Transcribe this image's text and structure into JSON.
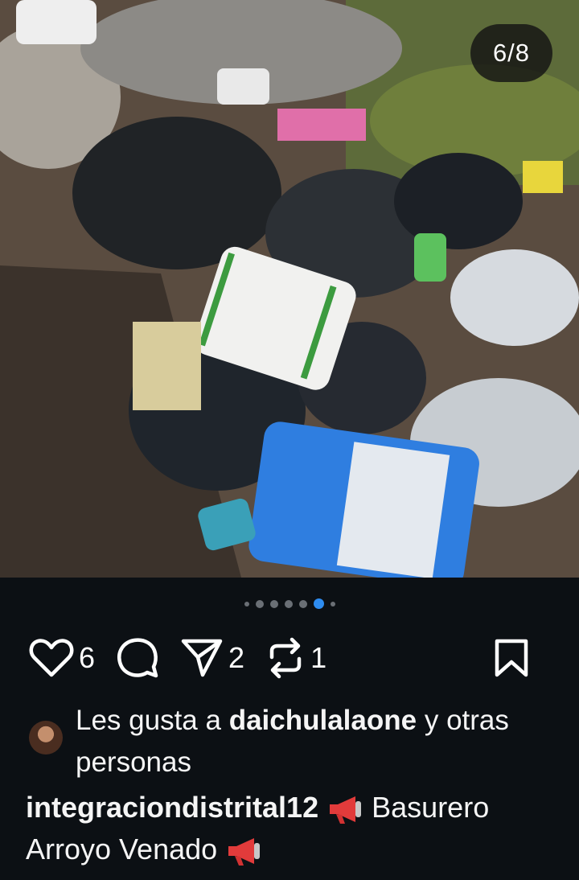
{
  "post": {
    "image_counter": "6/8",
    "carousel": {
      "total_dots": 7,
      "active_index": 5
    }
  },
  "actions": {
    "likes_count": "6",
    "shares_count": "2",
    "reposts_count": "1"
  },
  "likes": {
    "prefix": "Les gusta a",
    "user": "daichulalaone",
    "suffix": "y otras personas"
  },
  "caption": {
    "username": "integraciondistrital12",
    "text_part1": "Basurero Arroyo Venado",
    "emoji": "megaphone-icon"
  },
  "colors": {
    "background": "#0c1014",
    "active_dot": "#2e8cf0"
  }
}
